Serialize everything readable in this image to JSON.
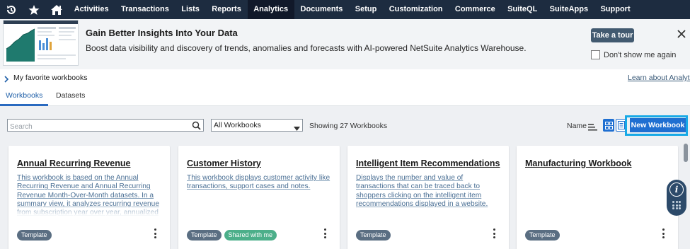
{
  "nav": {
    "icons": [
      "history-icon",
      "star-icon",
      "home-icon"
    ],
    "items": [
      {
        "label": "Activities"
      },
      {
        "label": "Transactions"
      },
      {
        "label": "Lists"
      },
      {
        "label": "Reports"
      },
      {
        "label": "Analytics",
        "active": true
      },
      {
        "label": "Documents"
      },
      {
        "label": "Setup"
      },
      {
        "label": "Customization"
      },
      {
        "label": "Commerce"
      },
      {
        "label": "SuiteQL"
      },
      {
        "label": "SuiteApps"
      },
      {
        "label": "Support"
      }
    ]
  },
  "banner": {
    "title": "Gain Better Insights Into Your Data",
    "subtitle": "Boost data visibility and discovery of trends, anomalies and forecasts with AI-powered NetSuite Analytics Warehouse.",
    "tour_button": "Take a tour",
    "dont_show": "Don't show me again"
  },
  "favorites": {
    "label": "My favorite workbooks",
    "learn_link": "Learn about Analytics"
  },
  "tabs": [
    {
      "label": "Workbooks",
      "active": true
    },
    {
      "label": "Datasets"
    }
  ],
  "toolbar": {
    "search_placeholder": "Search",
    "filter_value": "All Workbooks",
    "showing": "Showing 27 Workbooks",
    "sort_label": "Name",
    "new_workbook": "New Workbook"
  },
  "cards": [
    {
      "title": "Annual Recurring Revenue",
      "description": "This workbook is based on the Annual Recurring Revenue and Annual Recurring Revenue Month-Over-Month datasets. In a summary view, it analyzes recurring revenue from subscription year over year, annualized month over month",
      "badges": [
        "Template"
      ]
    },
    {
      "title": "Customer History",
      "description": "This workbook displays customer activity like transactions, support cases and notes.",
      "badges": [
        "Template",
        "Shared with me"
      ]
    },
    {
      "title": "Intelligent Item Recommendations",
      "description": "Displays the number and value of transactions that can be traced back to shoppers clicking on the intelligent item recommendations displayed in a website.",
      "badges": [
        "Template"
      ]
    },
    {
      "title": "Manufacturing Workbook",
      "description": "",
      "badges": [
        "Template"
      ]
    }
  ],
  "colors": {
    "nav_bg": "#1d2c40",
    "accent": "#1f6fd1",
    "highlight": "#17a9e6",
    "badge_template": "#5a6e82",
    "badge_shared": "#4caf8a"
  }
}
